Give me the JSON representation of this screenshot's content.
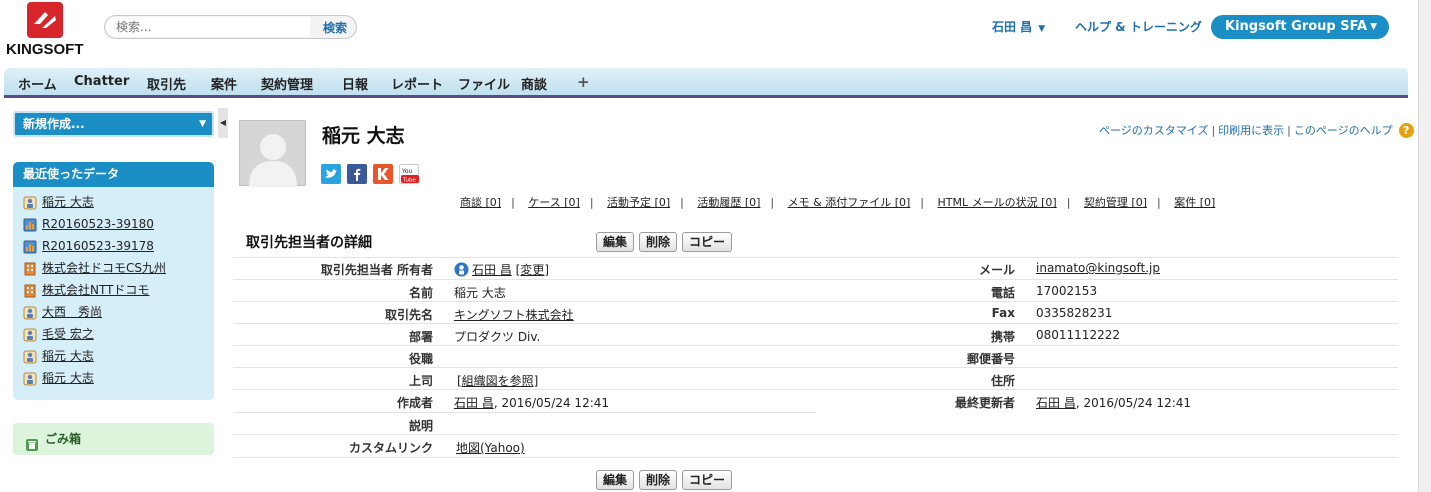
{
  "header": {
    "logo_text": "KINGSOFT",
    "search_placeholder": "検索...",
    "search_button": "検索",
    "user_name": "石田 昌",
    "help_link": "ヘルプ & トレーニング",
    "app_name": "Kingsoft Group SFA"
  },
  "tabs": [
    "ホーム",
    "Chatter",
    "取引先",
    "案件",
    "契約管理",
    "日報",
    "レポート",
    "ファイル",
    "商談"
  ],
  "tab_plus": "+",
  "sidebar": {
    "new_button": "新規作成...",
    "recent_title": "最近使ったデータ",
    "recent_items": [
      {
        "label": "稲元 大志",
        "icon": "contact-icon"
      },
      {
        "label": "R20160523-39180",
        "icon": "report-icon"
      },
      {
        "label": "R20160523-39178",
        "icon": "report-icon"
      },
      {
        "label": "株式会社ドコモCS九州",
        "icon": "account-icon"
      },
      {
        "label": "株式会社NTTドコモ",
        "icon": "account-icon"
      },
      {
        "label": "大西　秀尚",
        "icon": "contact-icon"
      },
      {
        "label": "毛受 宏之",
        "icon": "contact-icon"
      },
      {
        "label": "稲元 大志",
        "icon": "contact-icon"
      },
      {
        "label": "稲元 大志",
        "icon": "contact-icon"
      }
    ],
    "trash_label": "ごみ箱"
  },
  "record": {
    "name": "稲元 大志",
    "top_links": [
      "ページのカスタマイズ",
      "印刷用に表示",
      "このページのヘルプ"
    ],
    "related": [
      "商談 [0]",
      "ケース [0]",
      "活動予定 [0]",
      "活動履歴 [0]",
      "メモ & 添付ファイル [0]",
      "HTML メールの状況 [0]",
      "契約管理 [0]",
      "案件 [0]"
    ],
    "detail_title": "取引先担当者の詳細",
    "buttons": {
      "edit": "編集",
      "delete": "削除",
      "copy": "コピー"
    },
    "fields": {
      "owner_label": "取引先担当者 所有者",
      "owner_value": "石田 昌",
      "owner_change": "[変更]",
      "name_label": "名前",
      "name_value": "稲元 大志",
      "account_label": "取引先名",
      "account_value": "キングソフト株式会社",
      "dept_label": "部署",
      "dept_value": "プロダクツ Div.",
      "title_label": "役職",
      "manager_label": "上司",
      "manager_value": "[組織図を参照]",
      "created_label": "作成者",
      "created_user": "石田 昌",
      "created_date": ", 2016/05/24 12:41",
      "desc_label": "説明",
      "custom_label": "カスタムリンク",
      "custom_value": "地図(Yahoo)",
      "email_label": "メール",
      "email_value": "inamato@kingsoft.jp",
      "phone_label": "電話",
      "phone_value": "17002153",
      "fax_label": "Fax",
      "fax_value": "0335828231",
      "mobile_label": "携帯",
      "mobile_value": "08011112222",
      "zip_label": "郵便番号",
      "address_label": "住所",
      "modified_label": "最終更新者",
      "modified_user": "石田 昌",
      "modified_date": ", 2016/05/24 12:41"
    }
  }
}
